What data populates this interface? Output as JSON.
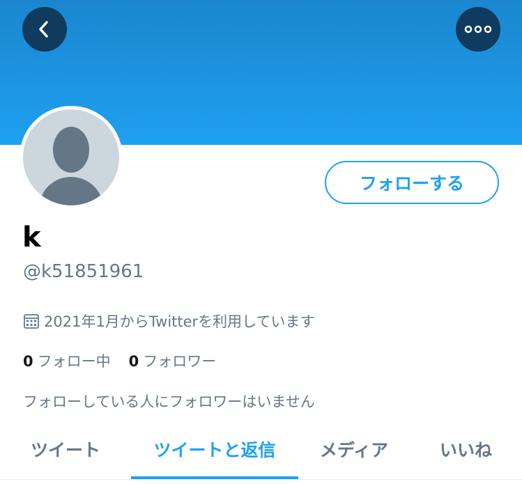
{
  "header": {
    "back_icon": "chevron-left-icon",
    "more_icon": "more-horizontal-icon"
  },
  "profile": {
    "avatar_icon": "default-avatar-icon",
    "follow_label": "フォローする",
    "display_name": "k",
    "handle": "@k51851961",
    "joined_icon": "calendar-icon",
    "joined_text": "2021年1月からTwitterを利用しています",
    "following_count": "0",
    "following_label": "フォロー中",
    "followers_count": "0",
    "followers_label": "フォロワー",
    "followed_by_text": "フォローしている人にフォロワーはいません"
  },
  "tabs": [
    {
      "label": "ツイート",
      "active": false
    },
    {
      "label": "ツイートと返信",
      "active": true
    },
    {
      "label": "メディア",
      "active": false
    },
    {
      "label": "いいね",
      "active": false
    }
  ],
  "colors": {
    "accent": "#1da1f2",
    "banner": "#1b86cf",
    "button_dark": "#0f3b5e",
    "secondary_text": "#657786"
  }
}
